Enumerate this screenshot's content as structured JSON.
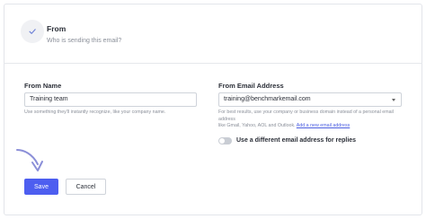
{
  "section": {
    "title": "From",
    "subtitle": "Who is sending this email?"
  },
  "from_name": {
    "label": "From Name",
    "value": "Training team",
    "help": "Use something they'll instantly recognize, like your company name."
  },
  "from_email": {
    "label": "From Email Address",
    "value": "training@benchmarkemail.com",
    "help_line1": "For best results, use your company or business domain instead of a personal email address",
    "help_line2": "like Gmail, Yahoo, AOL and Outlook.",
    "add_link": "Add a new email address"
  },
  "reply_toggle": {
    "label": "Use a different email address for replies",
    "on": false
  },
  "buttons": {
    "save": "Save",
    "cancel": "Cancel"
  },
  "colors": {
    "accent": "#4d5ef0",
    "arrow": "#8b8fd8"
  },
  "icons": {
    "step": "check-icon",
    "select": "caret-down-icon",
    "pointer": "curved-arrow-icon"
  }
}
